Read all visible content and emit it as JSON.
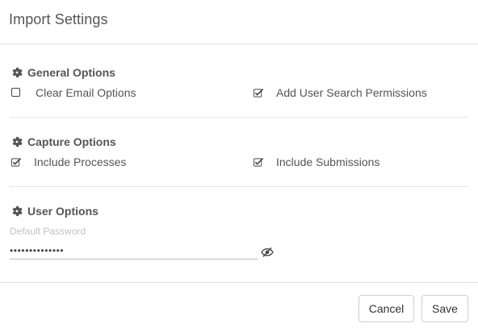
{
  "dialog": {
    "title": "Import Settings"
  },
  "sections": {
    "general": {
      "title": "General Options",
      "icon": "gear-icon",
      "options": [
        {
          "label": "Clear Email Options",
          "checked": false
        },
        {
          "label": "Add User Search Permissions",
          "checked": true
        }
      ]
    },
    "capture": {
      "title": "Capture Options",
      "icon": "gear-icon",
      "options": [
        {
          "label": "Include Processes",
          "checked": true
        },
        {
          "label": "Include Submissions",
          "checked": true
        }
      ]
    },
    "user": {
      "title": "User Options",
      "icon": "gear-icon",
      "password_label": "Default Password",
      "password_value": "••••••••••••••",
      "toggle_icon": "eye-slash-icon"
    }
  },
  "footer": {
    "cancel_label": "Cancel",
    "save_label": "Save"
  },
  "colors": {
    "text": "#555555",
    "border": "#dcdcdc",
    "placeholder": "#c2c2c2"
  }
}
